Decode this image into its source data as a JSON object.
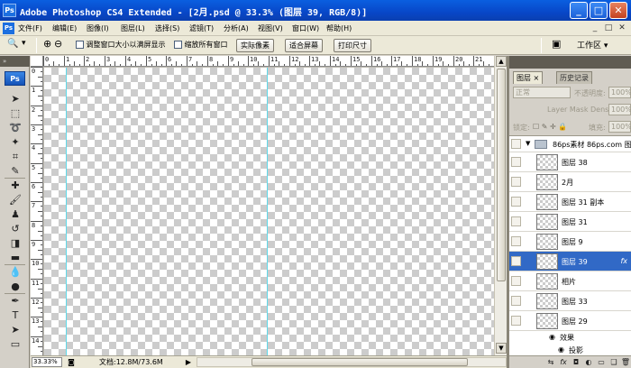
{
  "window": {
    "title": "Adobe Photoshop CS4 Extended - [2月.psd @ 33.3% (图层 39, RGB/8)]",
    "app_icon": "Ps",
    "minimize": "_",
    "maximize": "□",
    "close": "✕"
  },
  "menubar": {
    "app_icon": "Ps",
    "items": [
      "文件(F)",
      "编辑(E)",
      "图像(I)",
      "图层(L)",
      "选择(S)",
      "滤镜(T)",
      "分析(A)",
      "视图(V)",
      "窗口(W)",
      "帮助(H)"
    ],
    "doc_controls": [
      "_",
      "□",
      "✕"
    ]
  },
  "options": {
    "tool_icon": "🔍",
    "tool_dropdown": "▾",
    "zoom_in": "⊕",
    "zoom_out": "⊖",
    "resize_windows_label": "调整窗口大小以满屏显示",
    "zoom_all_label": "缩放所有窗口",
    "actual_pixels": "实际像素",
    "fit_screen": "适合屏幕",
    "print_size": "打印尺寸",
    "workspace_icon": "▣",
    "workspace_label": "工作区 ▾"
  },
  "toolbox": {
    "collapse": "»",
    "badge": "Ps",
    "tools": [
      {
        "name": "move-tool-icon",
        "glyph": "➤"
      },
      {
        "name": "marquee-tool-icon",
        "glyph": "⬚"
      },
      {
        "name": "lasso-tool-icon",
        "glyph": "➰"
      },
      {
        "name": "magic-wand-tool-icon",
        "glyph": "✦"
      },
      {
        "name": "crop-tool-icon",
        "glyph": "⌗"
      },
      {
        "name": "eyedropper-tool-icon",
        "glyph": "✎"
      },
      {
        "name": "healing-brush-tool-icon",
        "glyph": "✚"
      },
      {
        "name": "brush-tool-icon",
        "glyph": "🖌"
      },
      {
        "name": "clone-stamp-tool-icon",
        "glyph": "♟"
      },
      {
        "name": "history-brush-tool-icon",
        "glyph": "↺"
      },
      {
        "name": "eraser-tool-icon",
        "glyph": "◨"
      },
      {
        "name": "gradient-tool-icon",
        "glyph": "▬"
      },
      {
        "name": "blur-tool-icon",
        "glyph": "💧"
      },
      {
        "name": "dodge-tool-icon",
        "glyph": "●"
      },
      {
        "name": "pen-tool-icon",
        "glyph": "✒"
      },
      {
        "name": "type-tool-icon",
        "glyph": "T"
      },
      {
        "name": "path-selection-tool-icon",
        "glyph": "➤"
      },
      {
        "name": "shape-tool-icon",
        "glyph": "▭"
      }
    ]
  },
  "rulers": {
    "horizontal_labels": [
      "0",
      "1",
      "2",
      "3",
      "4",
      "5",
      "6",
      "7",
      "8",
      "9",
      "10",
      "11",
      "12",
      "13",
      "14",
      "15",
      "16",
      "17",
      "18",
      "19",
      "20",
      "21"
    ],
    "vertical_labels": [
      "0",
      "1",
      "2",
      "3",
      "4",
      "5",
      "6",
      "7",
      "8",
      "9",
      "10",
      "11",
      "12",
      "13",
      "14"
    ]
  },
  "status": {
    "zoom": "33.33%",
    "doc_info": "文档:12.8M/73.6M",
    "nav_right": "▶",
    "nav_left": "◀"
  },
  "layers_panel": {
    "tabs": [
      "图层 ×",
      "历史记录"
    ],
    "blend_mode": "正常",
    "opacity_label": "不透明度:",
    "opacity_value": "100%",
    "mask_density_label": "Layer Mask Density",
    "mask_density_value": "100%",
    "lock_label": "锁定:",
    "lock_icons": "☐ ✎ ✛ 🔒",
    "fill_label": "填充:",
    "fill_value": "100%",
    "group_name": "86ps素材 86ps.com 图层",
    "layers": [
      {
        "name": "图层 38",
        "selected": false
      },
      {
        "name": "2月",
        "selected": false
      },
      {
        "name": "图层 31 副本",
        "selected": false
      },
      {
        "name": "图层 31",
        "selected": false
      },
      {
        "name": "图层 9",
        "selected": false
      },
      {
        "name": "图层 39",
        "selected": true
      },
      {
        "name": "相片",
        "selected": false
      },
      {
        "name": "图层 33",
        "selected": false
      },
      {
        "name": "图层 29",
        "selected": false
      }
    ],
    "effects_label": "效果",
    "effect_item": "投影",
    "fx": "fx",
    "bottom_icons": [
      "⇆",
      "fx",
      "◘",
      "◐",
      "▭",
      "❑",
      "🗑"
    ]
  }
}
